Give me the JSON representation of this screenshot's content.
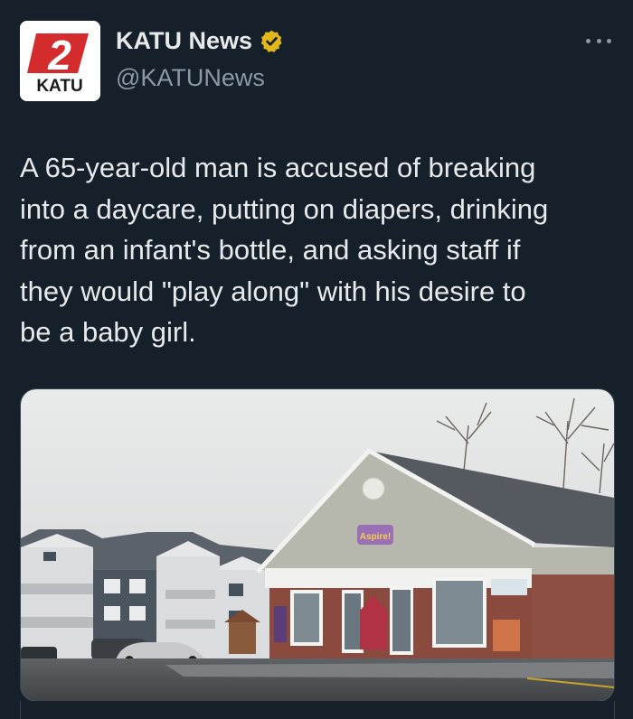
{
  "author": {
    "name": "KATU News",
    "handle": "@KATUNews",
    "verified": true,
    "avatar": {
      "logo_number": "2",
      "logo_text": "KATU",
      "colors": {
        "red": "#d42c2c",
        "dark": "#1a1a1a"
      }
    }
  },
  "more_icon": "more-horizontal-icon",
  "tweet": {
    "text": "A 65-year-old man is accused of breaking\ninto a daycare, putting on diapers, drinking\nfrom an infant's bottle, and asking staff if\nthey would \"play along\" with his desire to\nbe a baby girl."
  },
  "media": {
    "description_icon": "photo",
    "sign_text": "Aspire!"
  },
  "colors": {
    "background": "#15202b",
    "text_primary": "#e7e9ea",
    "text_secondary": "#8b98a5",
    "verified_gold": "#e2b719",
    "border": "#38444d"
  }
}
